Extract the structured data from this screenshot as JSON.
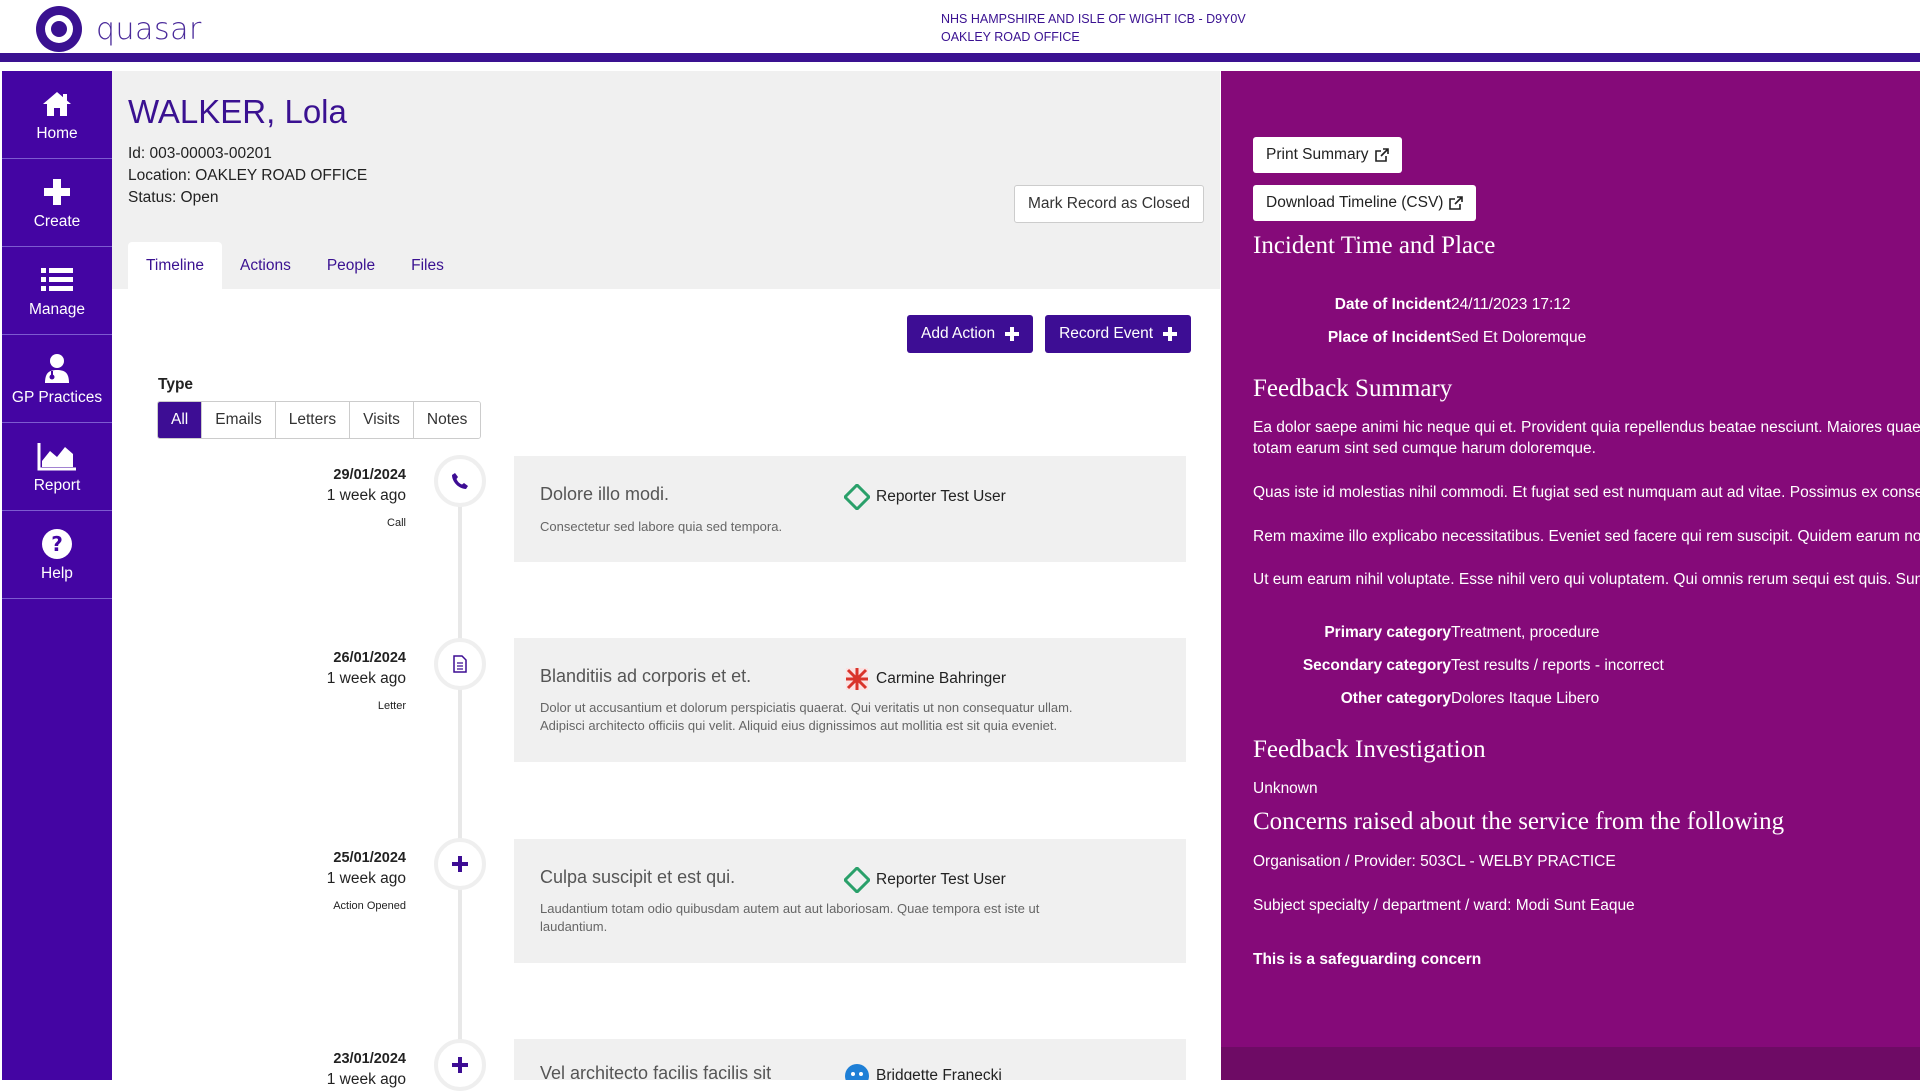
{
  "header": {
    "logo_text": "quasar",
    "org_line1": "NHS HAMPSHIRE AND ISLE OF WIGHT ICB - D9Y0V",
    "org_line2": "OAKLEY ROAD OFFICE"
  },
  "nav": [
    {
      "label": "Home",
      "icon": "home-icon"
    },
    {
      "label": "Create",
      "icon": "plus-icon"
    },
    {
      "label": "Manage",
      "icon": "list-icon"
    },
    {
      "label": "GP Practices",
      "icon": "doctor-icon"
    },
    {
      "label": "Report",
      "icon": "chart-icon"
    },
    {
      "label": "Help",
      "icon": "question-icon"
    }
  ],
  "patient": {
    "name": "WALKER, Lola",
    "id": "Id: 003-00003-00201",
    "location": "Location: OAKLEY ROAD OFFICE",
    "status": "Status: Open",
    "close_button": "Mark Record as Closed"
  },
  "tabs": [
    "Timeline",
    "Actions",
    "People",
    "Files"
  ],
  "actions": {
    "add_action": "Add Action",
    "record_event": "Record Event"
  },
  "filter": {
    "label": "Type",
    "options": [
      "All",
      "Emails",
      "Letters",
      "Visits",
      "Notes"
    ],
    "selected": "All"
  },
  "events": [
    {
      "date": "29/01/2024",
      "ago": "1 week ago",
      "type": "Call",
      "icon": "phone-icon",
      "title": "Dolore illo modi.",
      "user": "Reporter Test User",
      "user_icon": "green-diamond-avatar",
      "body": [
        "Consectetur sed labore quia sed tempora."
      ]
    },
    {
      "date": "26/01/2024",
      "ago": "1 week ago",
      "type": "Letter",
      "icon": "document-icon",
      "title": "Blanditiis ad corporis et et.",
      "user": "Carmine Bahringer",
      "user_icon": "red-pattern-avatar",
      "body": [
        "Dolor ut accusantium et dolorum perspiciatis quaerat. Qui veritatis ut non consequatur ullam.",
        "Adipisci architecto officiis qui velit. Aliquid eius dignissimos aut mollitia est sit quia eveniet."
      ]
    },
    {
      "date": "25/01/2024",
      "ago": "1 week ago",
      "type": "Action Opened",
      "icon": "plus-icon",
      "title": "Culpa suscipit et est qui.",
      "user": "Reporter Test User",
      "user_icon": "green-diamond-avatar",
      "body": [
        "Laudantium totam odio quibusdam autem aut aut laboriosam. Quae tempora est iste ut",
        "laudantium."
      ]
    },
    {
      "date": "23/01/2024",
      "ago": "1 week ago",
      "type": "",
      "icon": "plus-icon",
      "title": "Vel architecto facilis facilis sit",
      "user": "Bridgette Franecki",
      "user_icon": "blue-avatar",
      "body": []
    }
  ],
  "summary": {
    "print_button": "Print Summary",
    "download_button": "Download Timeline (CSV)",
    "incident_heading": "Incident Time and Place",
    "date_label": "Date of Incident",
    "date_value": "24/11/2023 17:12",
    "place_label": "Place of Incident",
    "place_value": "Sed Et Doloremque",
    "feedback_heading": "Feedback Summary",
    "feedback_paragraphs": [
      [
        "Ea dolor saepe animi hic neque qui et. Provident quia repellendus beatae nesciunt. Maiores quae",
        "totam earum sint sed cumque harum doloremque."
      ],
      [
        "Quas iste id molestias nihil commodi. Et fugiat sed est numquam aut ad vitae. Possimus ex conse"
      ],
      [
        "Rem maxime illo explicabo necessitatibus. Eveniet sed facere qui rem suscipit. Quidem earum nob"
      ],
      [
        "Ut eum earum nihil voluptate. Esse nihil vero qui voluptatem. Qui omnis rerum sequi est quis. Sun"
      ]
    ],
    "primary_label": "Primary category",
    "primary_value": "Treatment, procedure",
    "secondary_label": "Secondary category",
    "secondary_value": "Test results / reports - incorrect",
    "other_label": "Other category",
    "other_value": "Dolores Itaque Libero",
    "investigation_heading": "Feedback Investigation",
    "investigation_value": "Unknown",
    "concerns_heading": "Concerns raised about the service from the following",
    "organisation": "Organisation / Provider: 503CL - WELBY PRACTICE",
    "specialty": "Subject specialty / department / ward: Modi Sunt Eaque",
    "safeguarding": "This is a safeguarding concern"
  },
  "colors": {
    "primary": "#3d0d94",
    "nav_bg": "#4405a3",
    "panel_bg": "#850a79"
  }
}
